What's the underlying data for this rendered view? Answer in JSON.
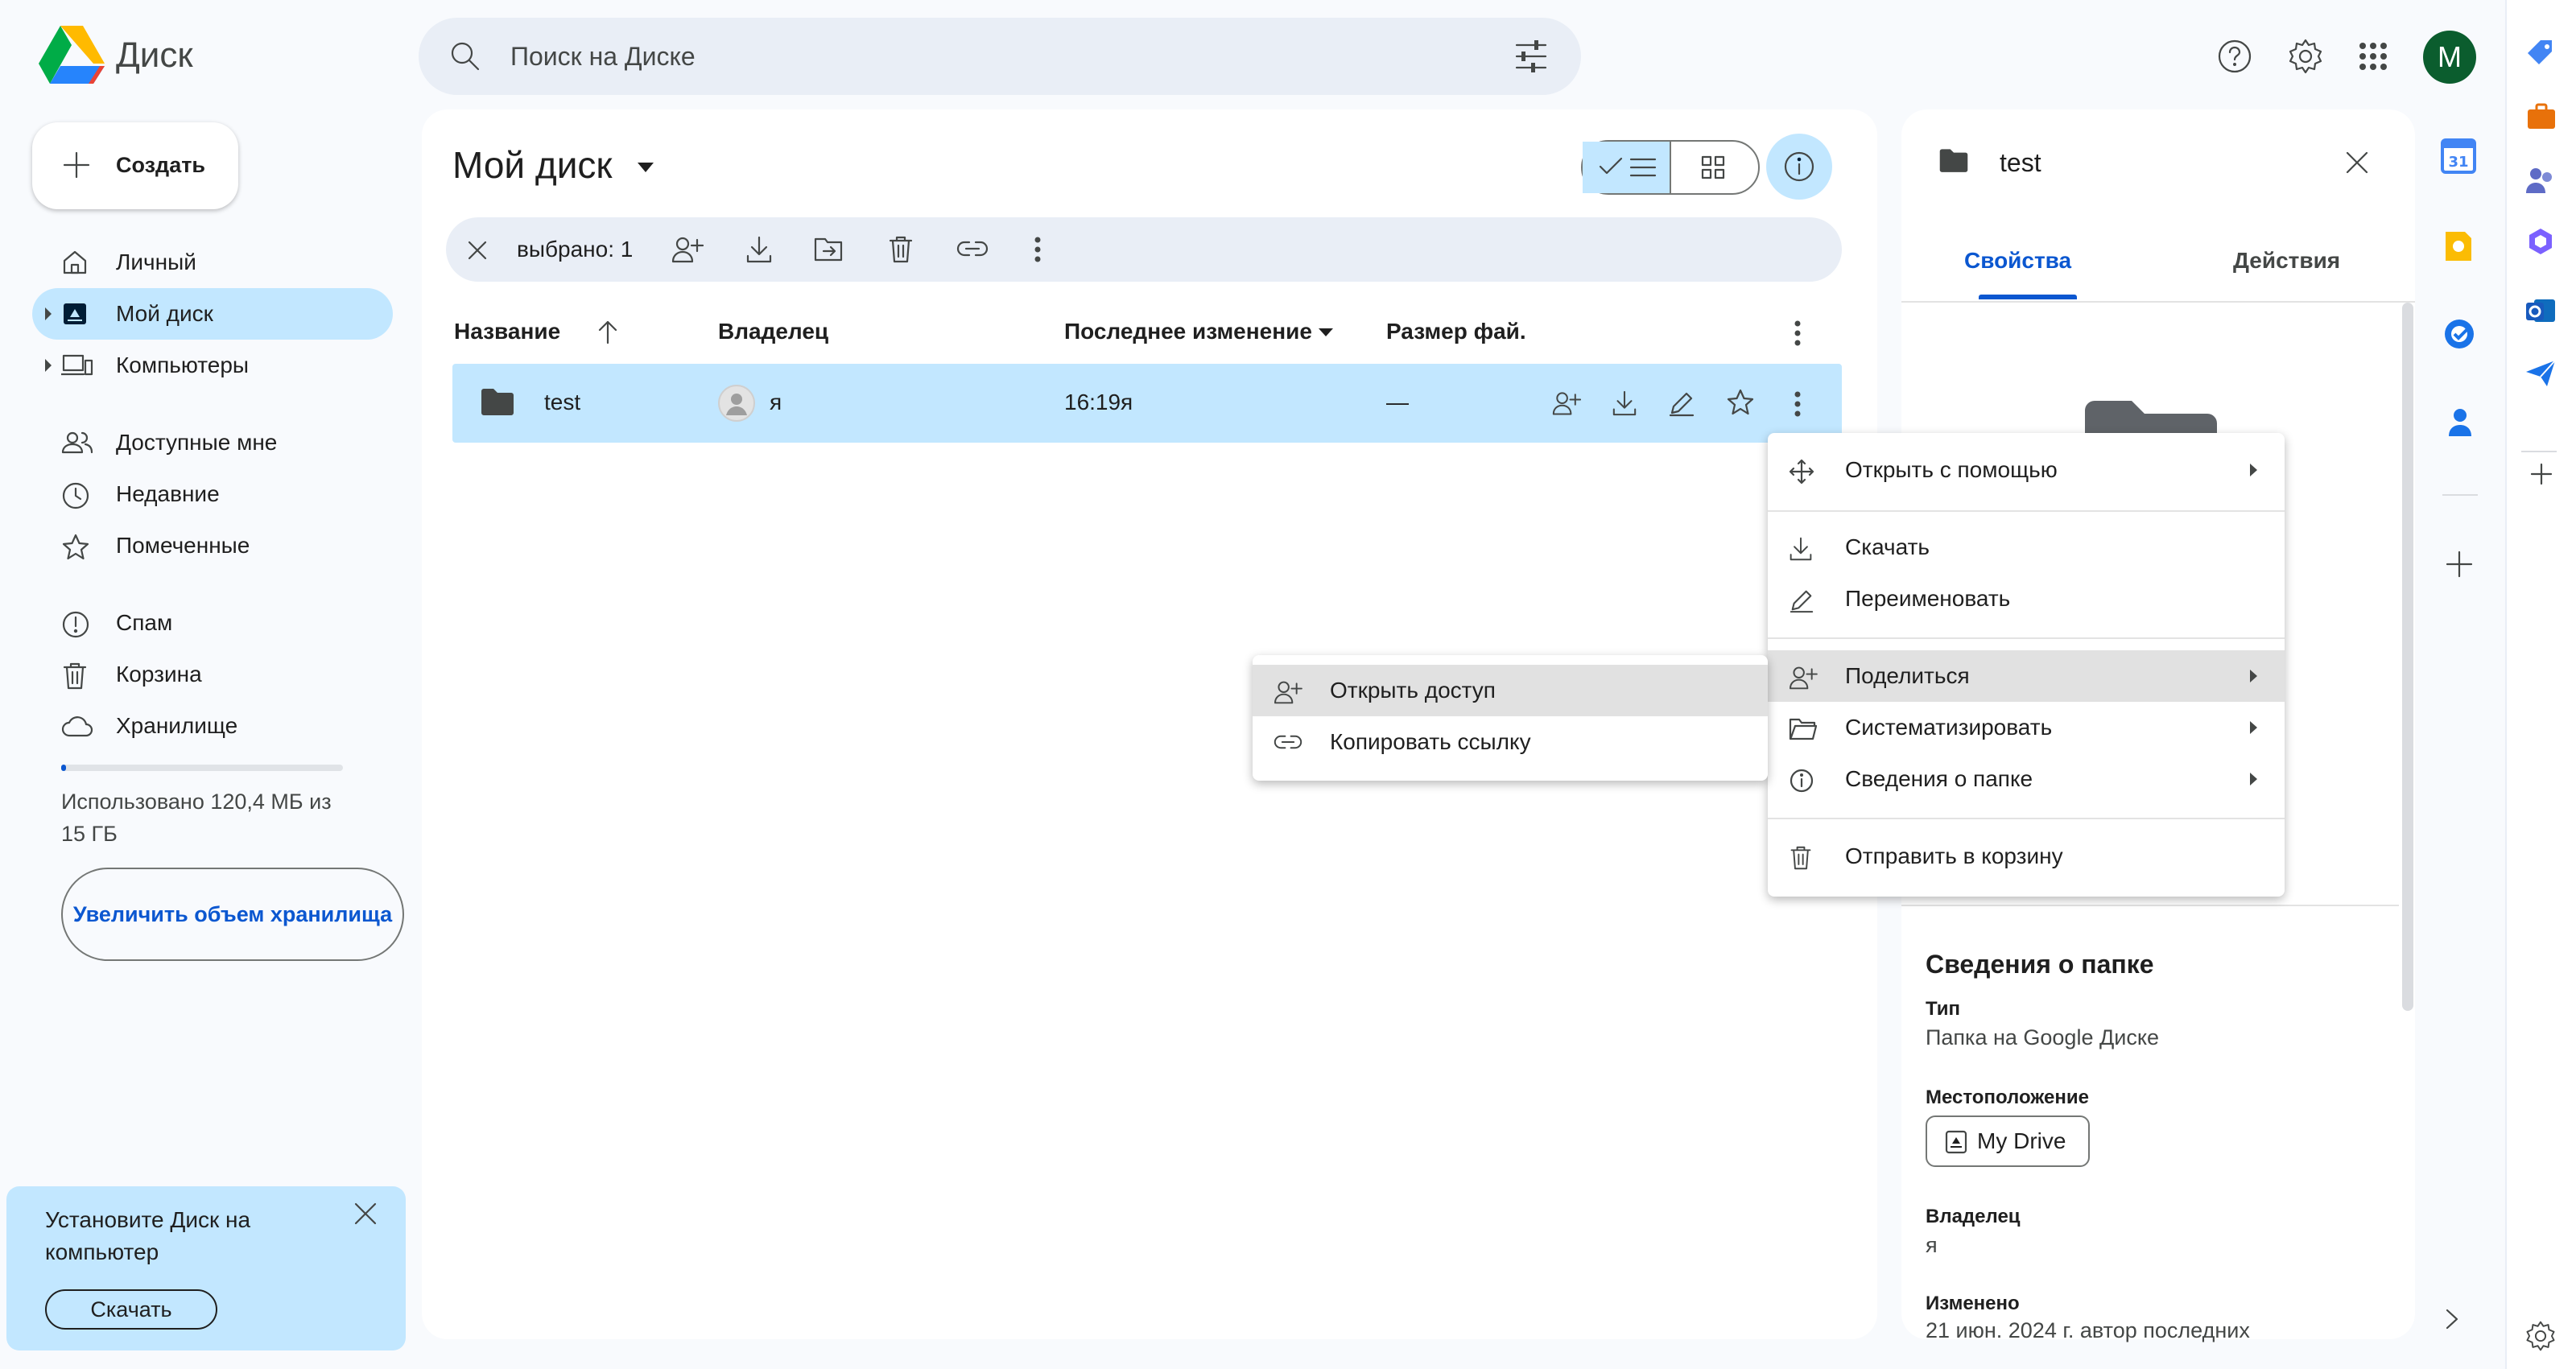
{
  "app": {
    "name": "Диск"
  },
  "search": {
    "placeholder": "Поиск на Диске"
  },
  "account": {
    "initial": "M"
  },
  "nav": {
    "create": "Создать",
    "items": [
      {
        "label": "Личный"
      },
      {
        "label": "Мой диск"
      },
      {
        "label": "Компьютеры"
      },
      {
        "label": "Доступные мне"
      },
      {
        "label": "Недавние"
      },
      {
        "label": "Помеченные"
      },
      {
        "label": "Спам"
      },
      {
        "label": "Корзина"
      },
      {
        "label": "Хранилище"
      }
    ],
    "storage_used_fraction": 0.008,
    "storage_text": "Использовано 120,4 МБ из 15 ГБ",
    "upgrade": "Увеличить объем хранилища"
  },
  "promo": {
    "text": "Установите Диск на компьютер",
    "button": "Скачать"
  },
  "main": {
    "title": "Мой диск",
    "selection": "выбрано: 1",
    "columns": {
      "name": "Название",
      "owner": "Владелец",
      "modified": "Последнее изменение",
      "size": "Размер фай."
    },
    "row": {
      "name": "test",
      "owner": "я",
      "modified_time": "16:19",
      "modified_by": "я",
      "size": "—"
    }
  },
  "context_menu": {
    "open_with": "Открыть с помощью",
    "download": "Скачать",
    "rename": "Переименовать",
    "share": "Поделиться",
    "organize": "Систематизировать",
    "folder_info": "Сведения о папке",
    "trash": "Отправить в корзину"
  },
  "share_submenu": {
    "open_access": "Открыть доступ",
    "copy_link": "Копировать ссылку"
  },
  "details": {
    "name": "test",
    "tabs": {
      "properties": "Свойства",
      "actions": "Действия"
    },
    "heading": "Сведения о папке",
    "type_label": "Тип",
    "type_value": "Папка на Google Диске",
    "location_label": "Местоположение",
    "location_value": "My Drive",
    "owner_label": "Владелец",
    "owner_value": "я",
    "modified_label": "Изменено",
    "modified_value": "21 июн. 2024 г. автор последних"
  },
  "colors": {
    "accent": "#0b57d0",
    "selected": "#c2e7ff",
    "avatar": "#0b5d2e"
  }
}
